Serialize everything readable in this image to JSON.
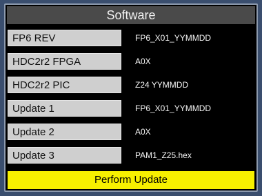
{
  "panel": {
    "title": "Software",
    "rows": [
      {
        "label": "FP6 REV",
        "value": "FP6_X01_YYMMDD"
      },
      {
        "label": "HDC2r2 FPGA",
        "value": "A0X"
      },
      {
        "label": "HDC2r2 PIC",
        "value": "Z24 YYMMDD"
      },
      {
        "label": "Update 1",
        "value": "FP6_X01_YYMMDD"
      },
      {
        "label": "Update 2",
        "value": "A0X"
      },
      {
        "label": "Update 3",
        "value": "PAM1_Z25.hex"
      }
    ],
    "perform_label": "Perform Update"
  }
}
